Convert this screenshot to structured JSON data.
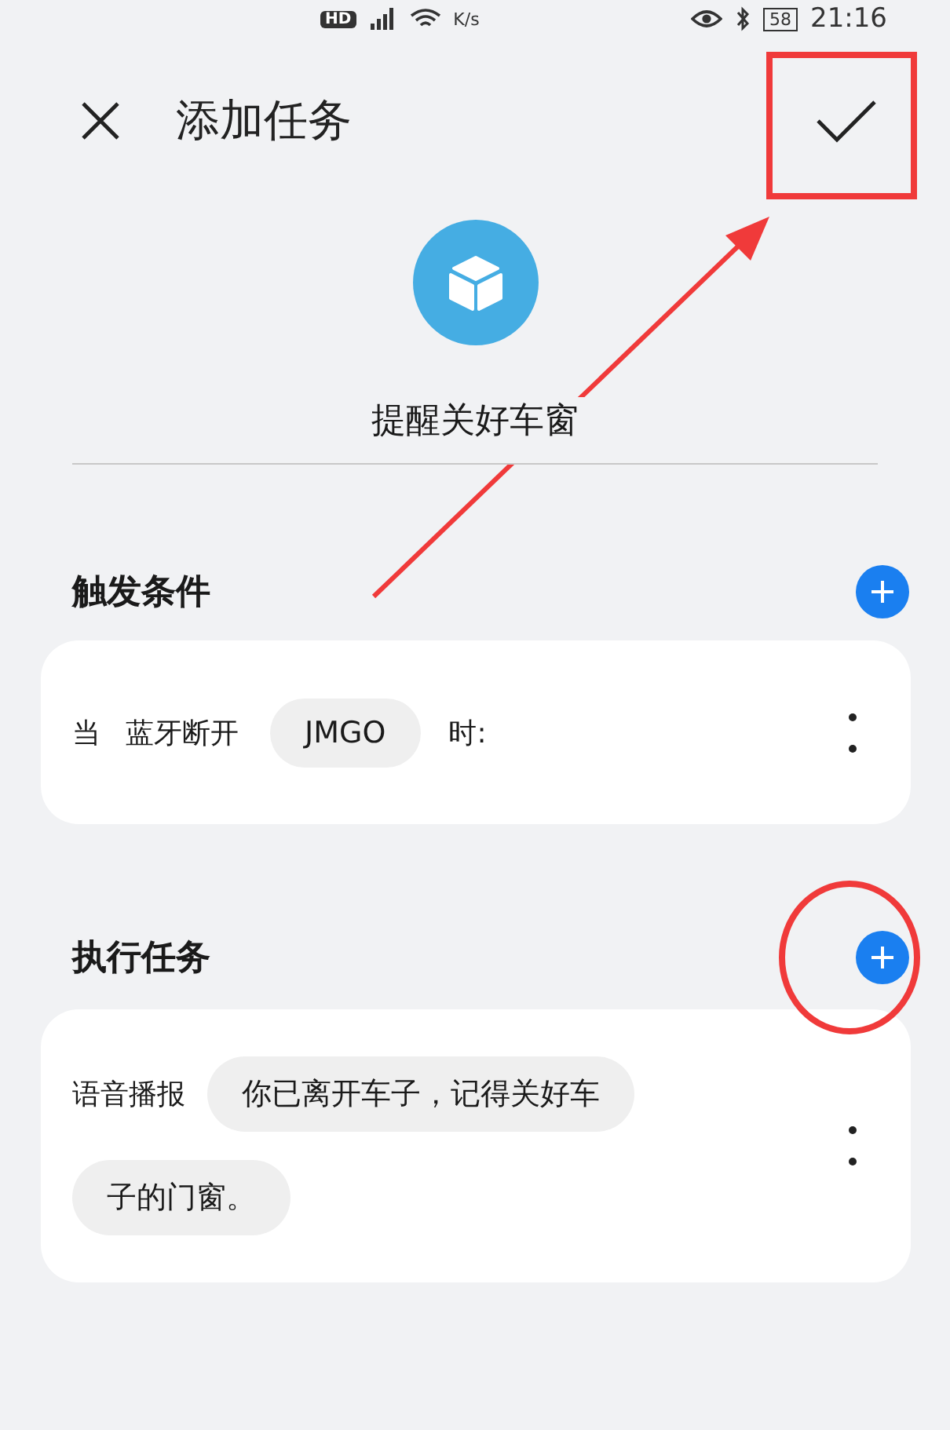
{
  "status_bar": {
    "badge": "HD",
    "speed_unit": "K/s",
    "battery": "58",
    "time": "21:16"
  },
  "header": {
    "title": "添加任务"
  },
  "task": {
    "name": "提醒关好车窗"
  },
  "trigger": {
    "title": "触发条件",
    "prefix": "当",
    "condition": "蓝牙断开",
    "device": "JMGO",
    "suffix": "时:"
  },
  "action": {
    "title": "执行任务",
    "label": "语音播报",
    "message_lines": [
      "你已离开车子，记得关好车",
      "子的门窗。"
    ]
  }
}
